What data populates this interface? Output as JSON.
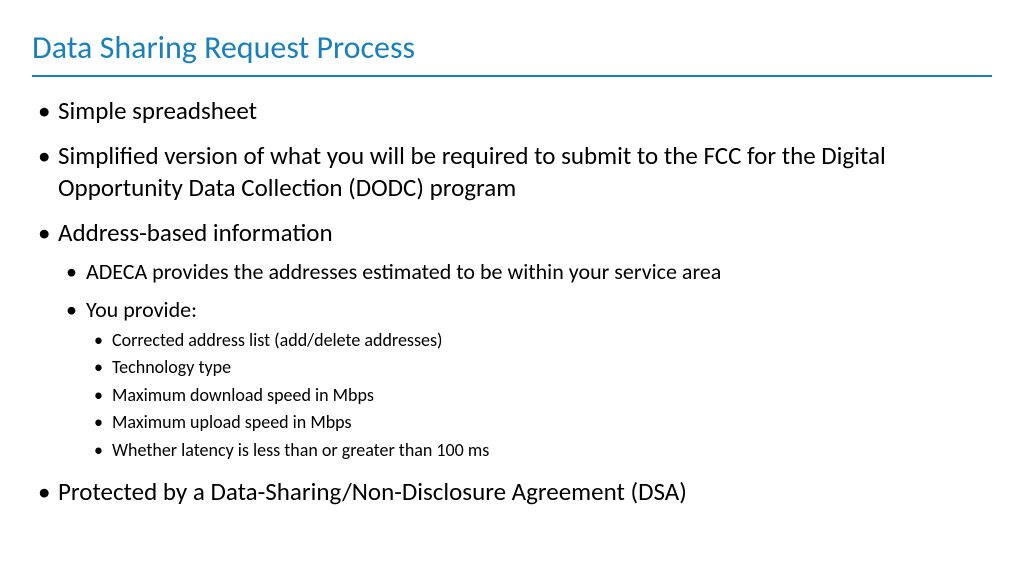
{
  "title": "Data Sharing Request Process",
  "bullets": {
    "b0": "Simple spreadsheet",
    "b1": "Simplified version of what you will be required to submit to the FCC for the Digital Opportunity Data Collection (DODC) program",
    "b2": "Address-based information",
    "b2sub": {
      "s0": "ADECA provides the addresses estimated to be within your service area",
      "s1": "You provide:",
      "s1sub": {
        "t0": "Corrected address list (add/delete addresses)",
        "t1": "Technology type",
        "t2": "Maximum download speed in Mbps",
        "t3": "Maximum upload speed in Mbps",
        "t4": "Whether latency is less than or greater than 100 ms"
      }
    },
    "b3": "Protected by a Data-Sharing/Non-Disclosure Agreement (DSA)"
  }
}
